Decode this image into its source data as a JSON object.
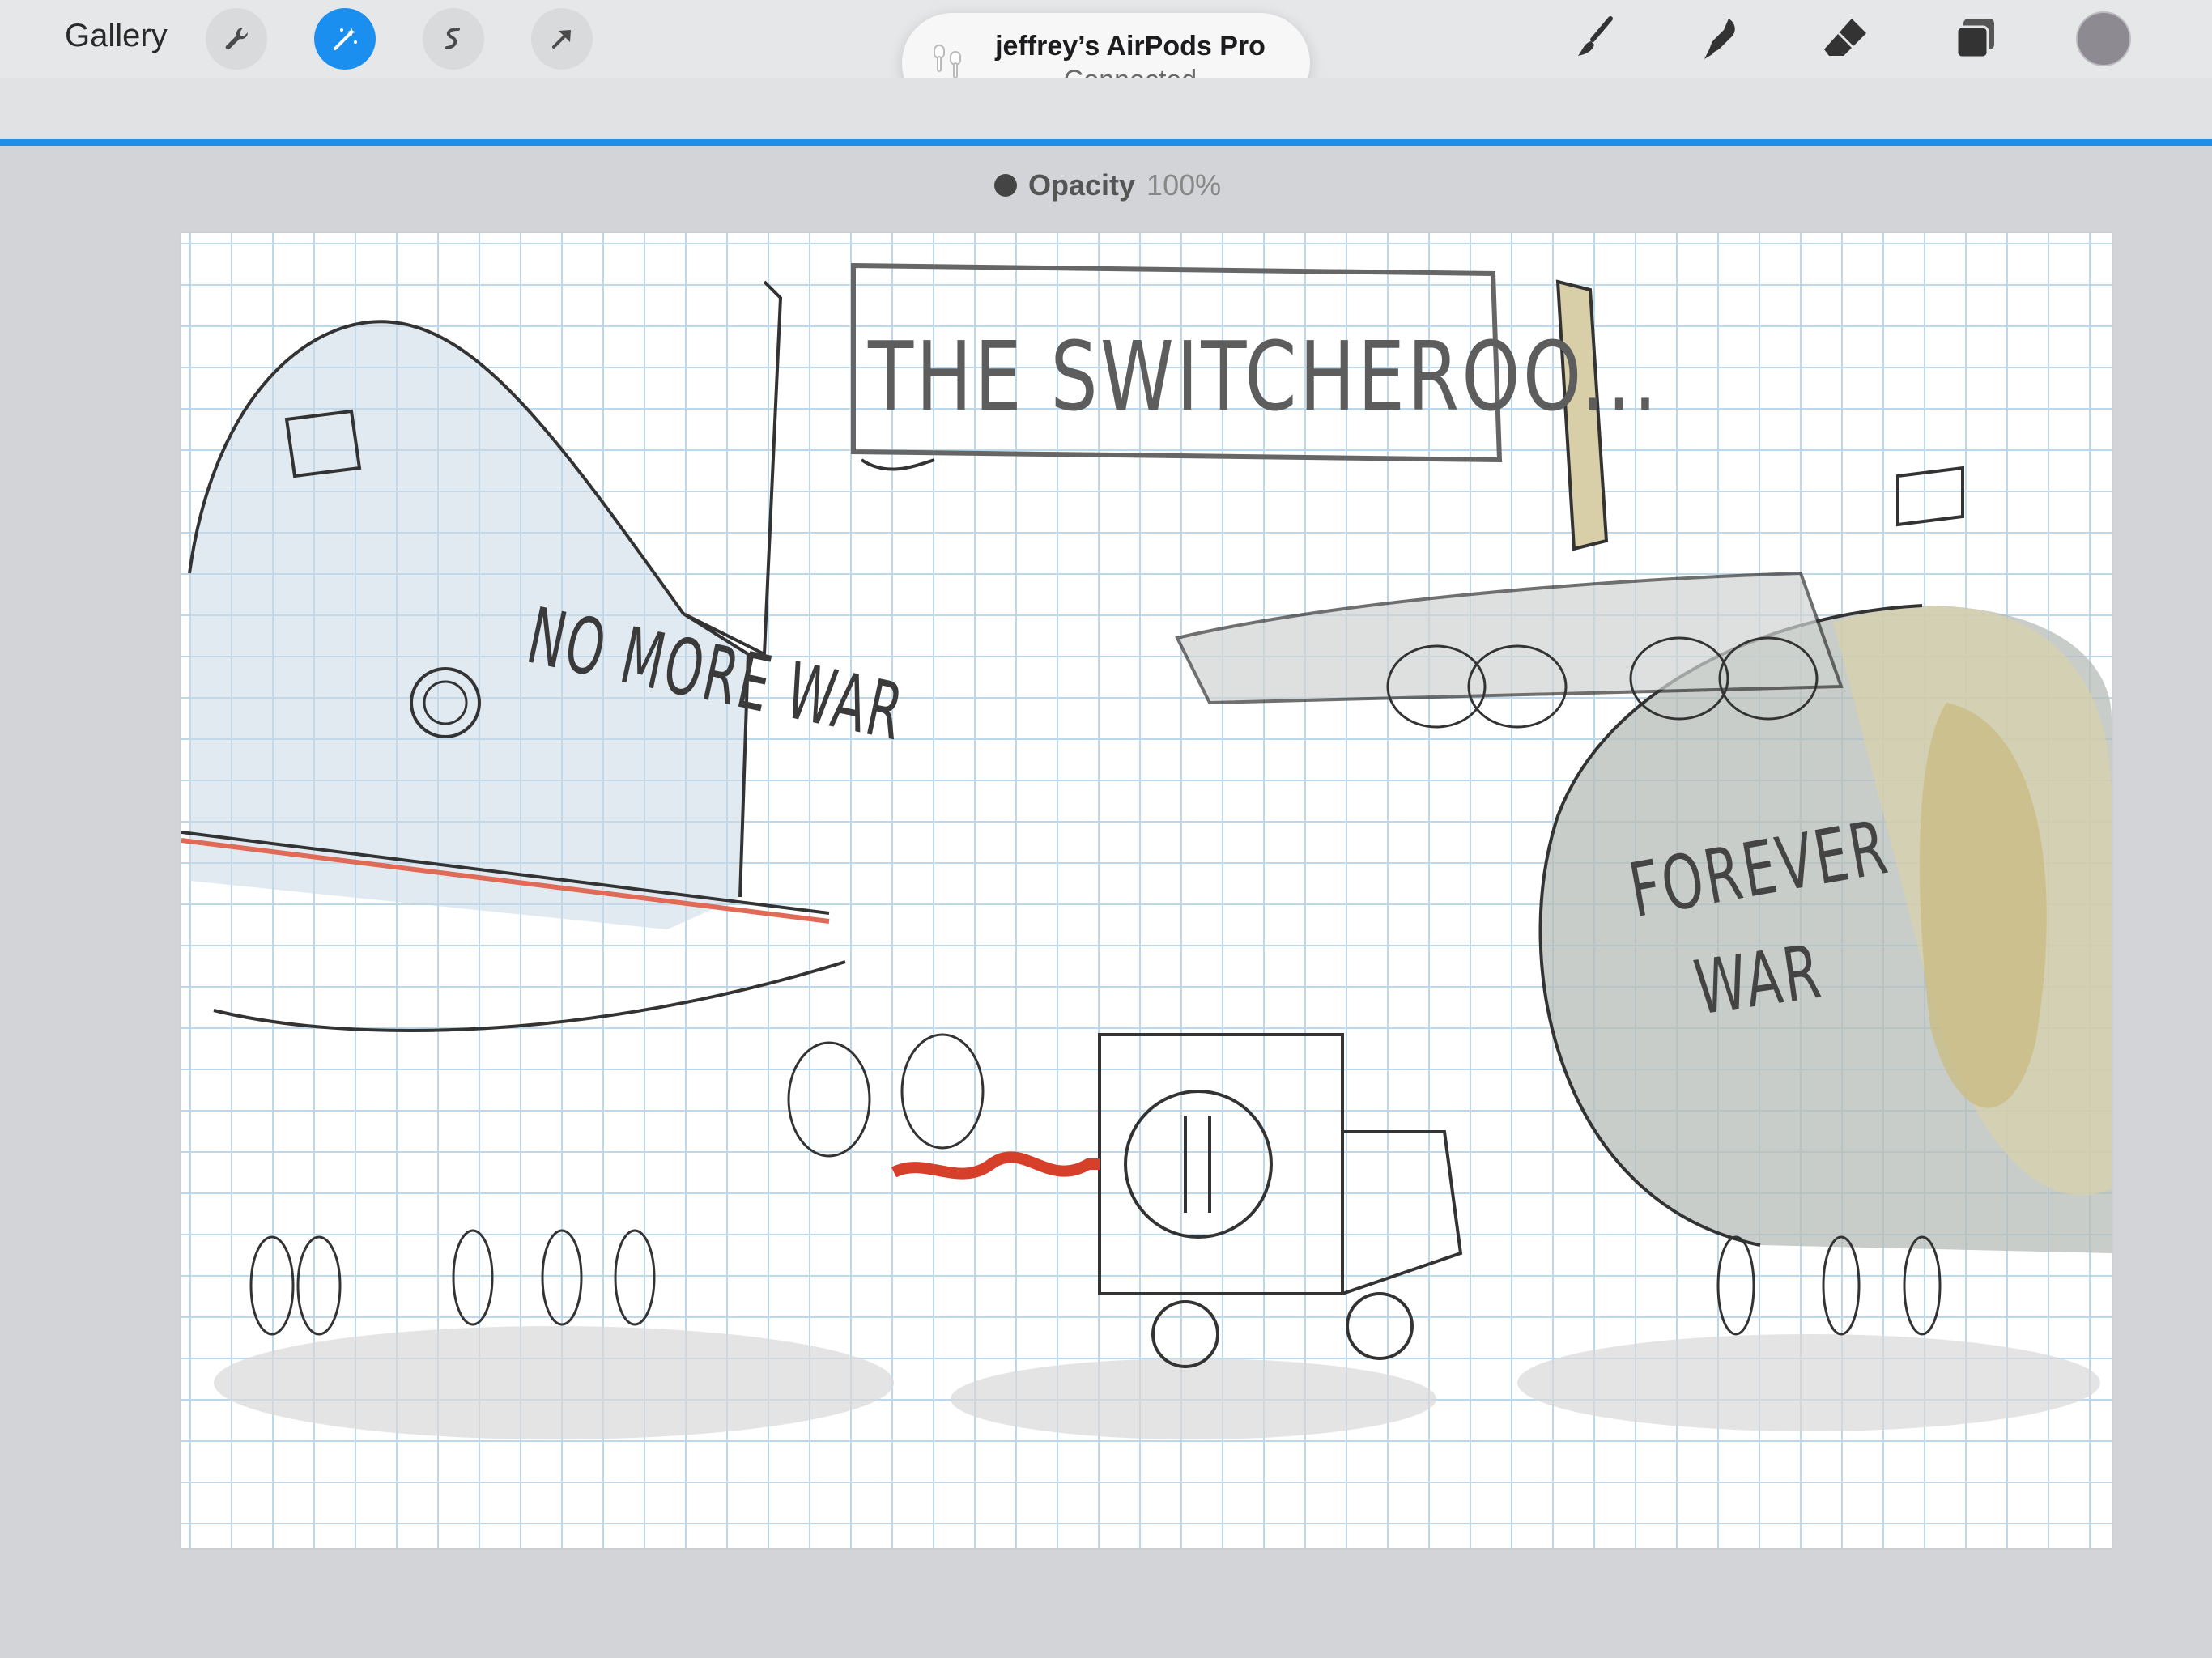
{
  "toolbar": {
    "gallery_label": "Gallery",
    "left_tools": [
      "wrench-icon",
      "magic-wand-icon",
      "selection-icon",
      "move-arrow-icon"
    ],
    "right_tools": [
      "brush-icon",
      "smudge-icon",
      "eraser-icon",
      "layers-icon"
    ],
    "accent_color": "#1b8ff0",
    "current_color": "#8e8a91"
  },
  "opacity_hint": {
    "label": "Opacity",
    "value": "100%"
  },
  "notification": {
    "title": "jeffrey’s AirPods Pro",
    "status": "Connected",
    "icon": "airpods-icon"
  },
  "canvas": {
    "title_text": "THE SWITCHEROO...",
    "left_plane_text": "NO MORE WAR",
    "right_plane_text_line1": "FOREVER",
    "right_plane_text_line2": "WAR"
  }
}
